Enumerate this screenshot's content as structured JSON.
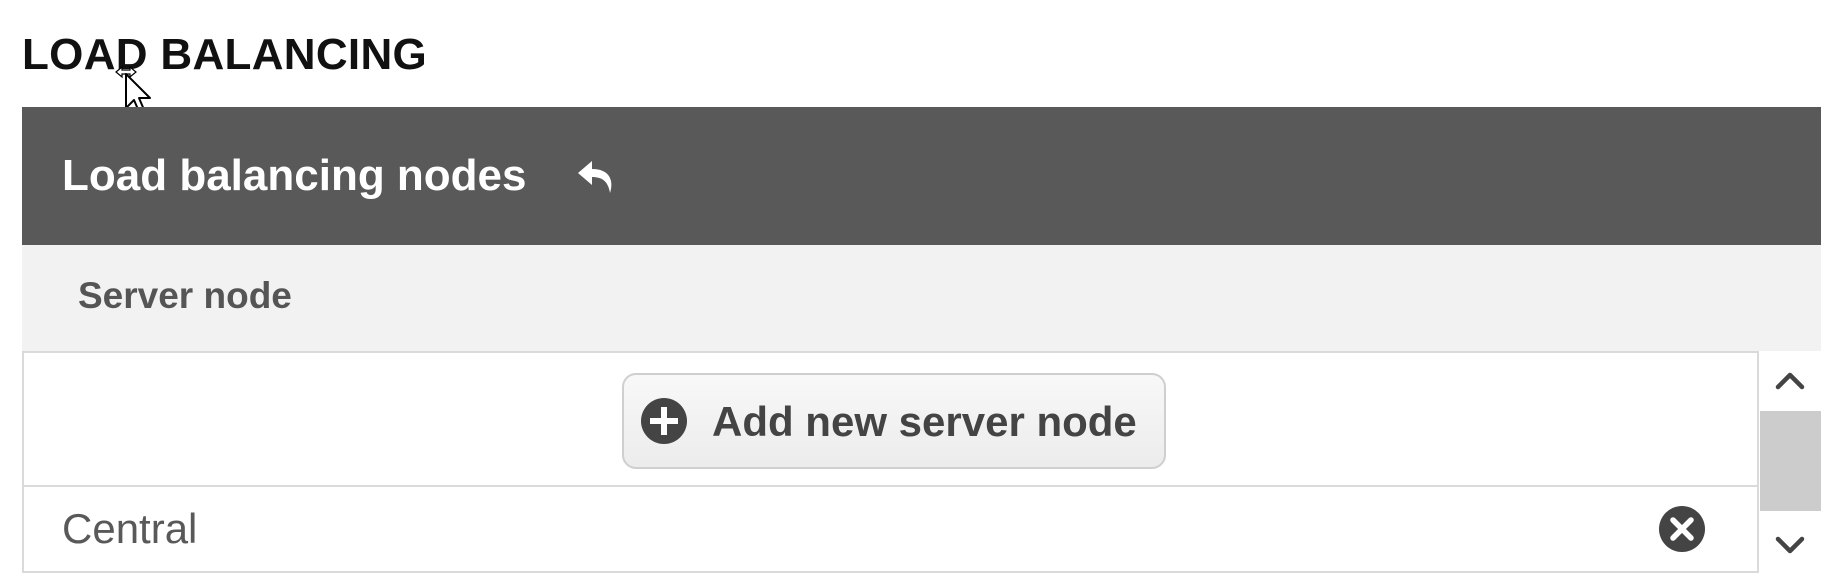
{
  "page": {
    "section_title": "LOAD BALANCING"
  },
  "panel": {
    "title": "Load balancing nodes",
    "undo_icon": "undo-arrow-icon",
    "header_color": "#595959"
  },
  "table": {
    "column_header": "Server node",
    "add_button_label": "Add new server node",
    "add_icon": "plus-circle-icon",
    "rows": [
      {
        "name": "Central",
        "remove_icon": "close-circle-icon"
      }
    ]
  },
  "scrollbar": {
    "up_icon": "chevron-up-icon",
    "down_icon": "chevron-down-icon"
  }
}
